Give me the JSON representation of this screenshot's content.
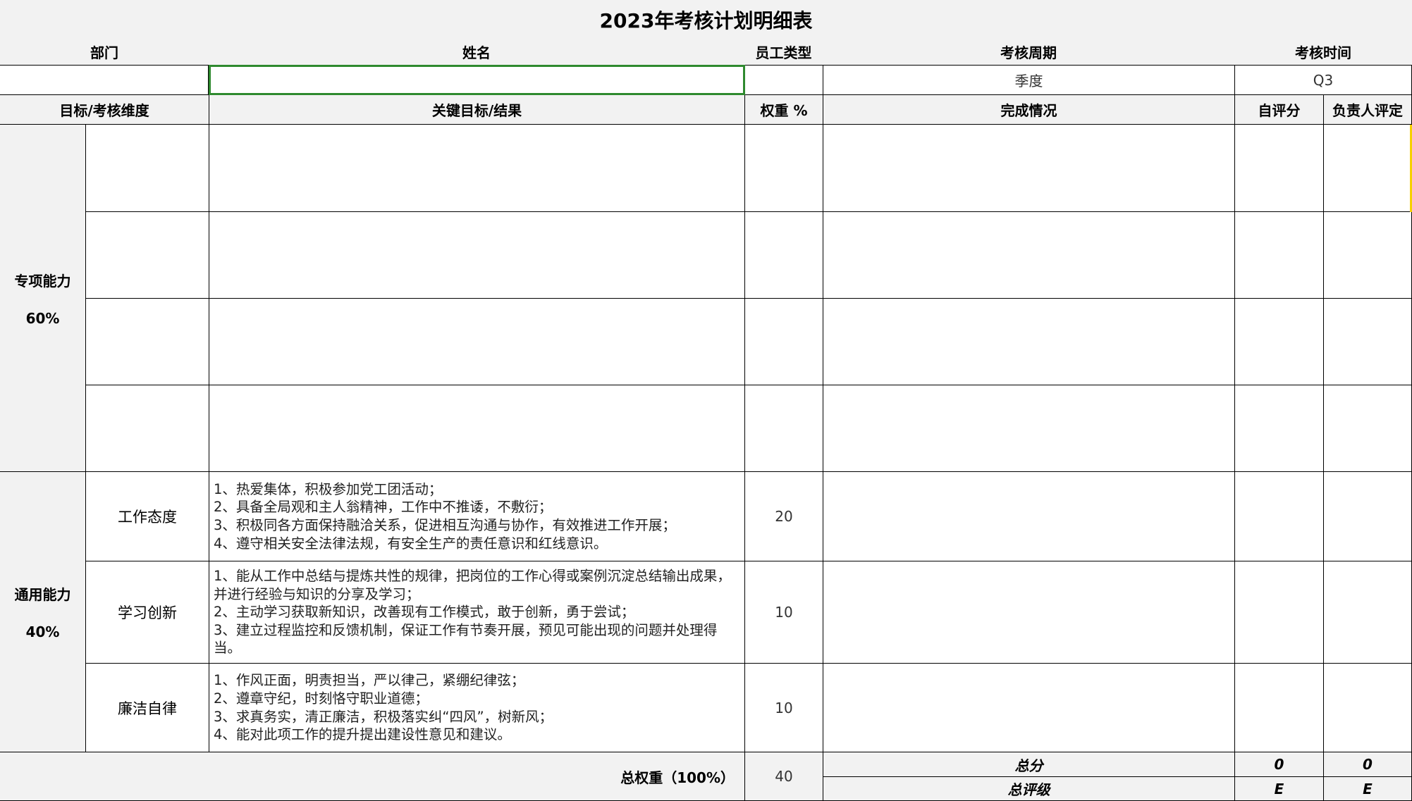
{
  "title": "2023年考核计划明细表",
  "header": {
    "department": "部门",
    "name": "姓名",
    "employee_type": "员工类型",
    "review_period": "考核周期",
    "review_time": "考核时间"
  },
  "info": {
    "department": "",
    "name": "",
    "employee_type": "",
    "review_period": "季度",
    "review_time": "Q3"
  },
  "columns": {
    "dimension": "目标/考核维度",
    "key_result": "关键目标/结果",
    "weight": "权重 %",
    "completion": "完成情况",
    "self_score": "自评分",
    "manager_score": "负责人评定"
  },
  "special": {
    "label": "专项能力",
    "percent": "60%"
  },
  "general": {
    "label": "通用能力",
    "percent": "40%",
    "rows": [
      {
        "name": "工作态度",
        "criteria": "1、热爱集体，积极参加党工团活动；\n2、具备全局观和主人翁精神，工作中不推诿，不敷衍；\n3、积极同各方面保持融洽关系，促进相互沟通与协作，有效推进工作开展；\n4、遵守相关安全法律法规，有安全生产的责任意识和红线意识。",
        "weight": "20"
      },
      {
        "name": "学习创新",
        "criteria": "1、能从工作中总结与提炼共性的规律，把岗位的工作心得或案例沉淀总结输出成果，并进行经验与知识的分享及学习；\n2、主动学习获取新知识，改善现有工作模式，敢于创新，勇于尝试；\n3、建立过程监控和反馈机制，保证工作有节奏开展，预见可能出现的问题并处理得当。",
        "weight": "10"
      },
      {
        "name": "廉洁自律",
        "criteria": "1、作风正面，明责担当，严以律己，紧绷纪律弦；\n2、遵章守纪，时刻恪守职业道德；\n3、求真务实，清正廉洁，积极落实纠“四风”，树新风；\n4、能对此项工作的提升提出建设性意见和建议。",
        "weight": "10"
      }
    ]
  },
  "footer": {
    "total_weight_label": "总权重（100%）",
    "total_weight": "40",
    "total_score_label": "总分",
    "total_grade_label": "总评级",
    "self_total": "0",
    "manager_total": "0",
    "self_grade": "E",
    "manager_grade": "E"
  }
}
